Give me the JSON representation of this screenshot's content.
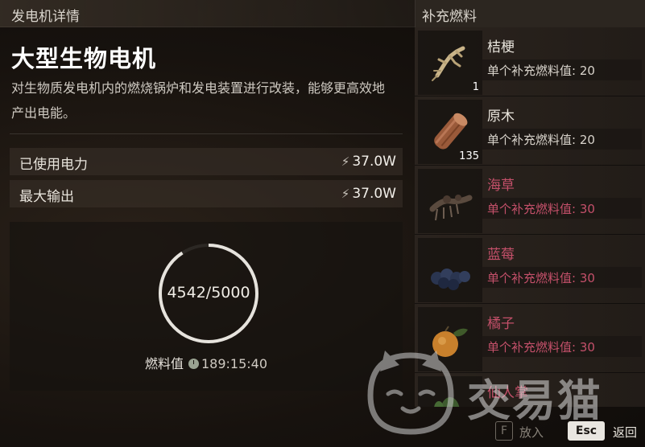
{
  "left_panel": {
    "header": "发电机详情",
    "title": "大型生物电机",
    "description": "对生物质发电机内的燃烧锅炉和发电装置进行改装，能够更高效地产出电能。",
    "stats": [
      {
        "label": "已使用电力",
        "value": "37.0W"
      },
      {
        "label": "最大输出",
        "value": "37.0W"
      }
    ],
    "fuel": {
      "display": "4542/5000",
      "current": 4542,
      "max": 5000,
      "label": "燃料值",
      "time": "189:15:40"
    }
  },
  "right_panel": {
    "header": "补充燃料",
    "items": [
      {
        "name": "桔梗",
        "value_text": "单个补充燃料值: 20",
        "count": "1",
        "icon": "platycodon-root-icon",
        "locked": false
      },
      {
        "name": "原木",
        "value_text": "单个补充燃料值: 20",
        "count": "135",
        "icon": "wood-log-icon",
        "locked": false
      },
      {
        "name": "海草",
        "value_text": "单个补充燃料值: 30",
        "count": "",
        "icon": "seaweed-icon",
        "locked": true
      },
      {
        "name": "蓝莓",
        "value_text": "单个补充燃料值: 30",
        "count": "",
        "icon": "blueberry-icon",
        "locked": true
      },
      {
        "name": "橘子",
        "value_text": "单个补充燃料值: 30",
        "count": "",
        "icon": "orange-icon",
        "locked": true
      },
      {
        "name": "仙人掌",
        "value_text": "",
        "count": "",
        "icon": "cactus-icon",
        "locked": true
      }
    ]
  },
  "controls": {
    "put_key": "F",
    "put_label": "放入",
    "back_key": "Esc",
    "back_label": "返回"
  },
  "watermark": "交易猫",
  "colors": {
    "locked_text": "#c4506a",
    "ring_stroke": "#e6e3dd"
  }
}
